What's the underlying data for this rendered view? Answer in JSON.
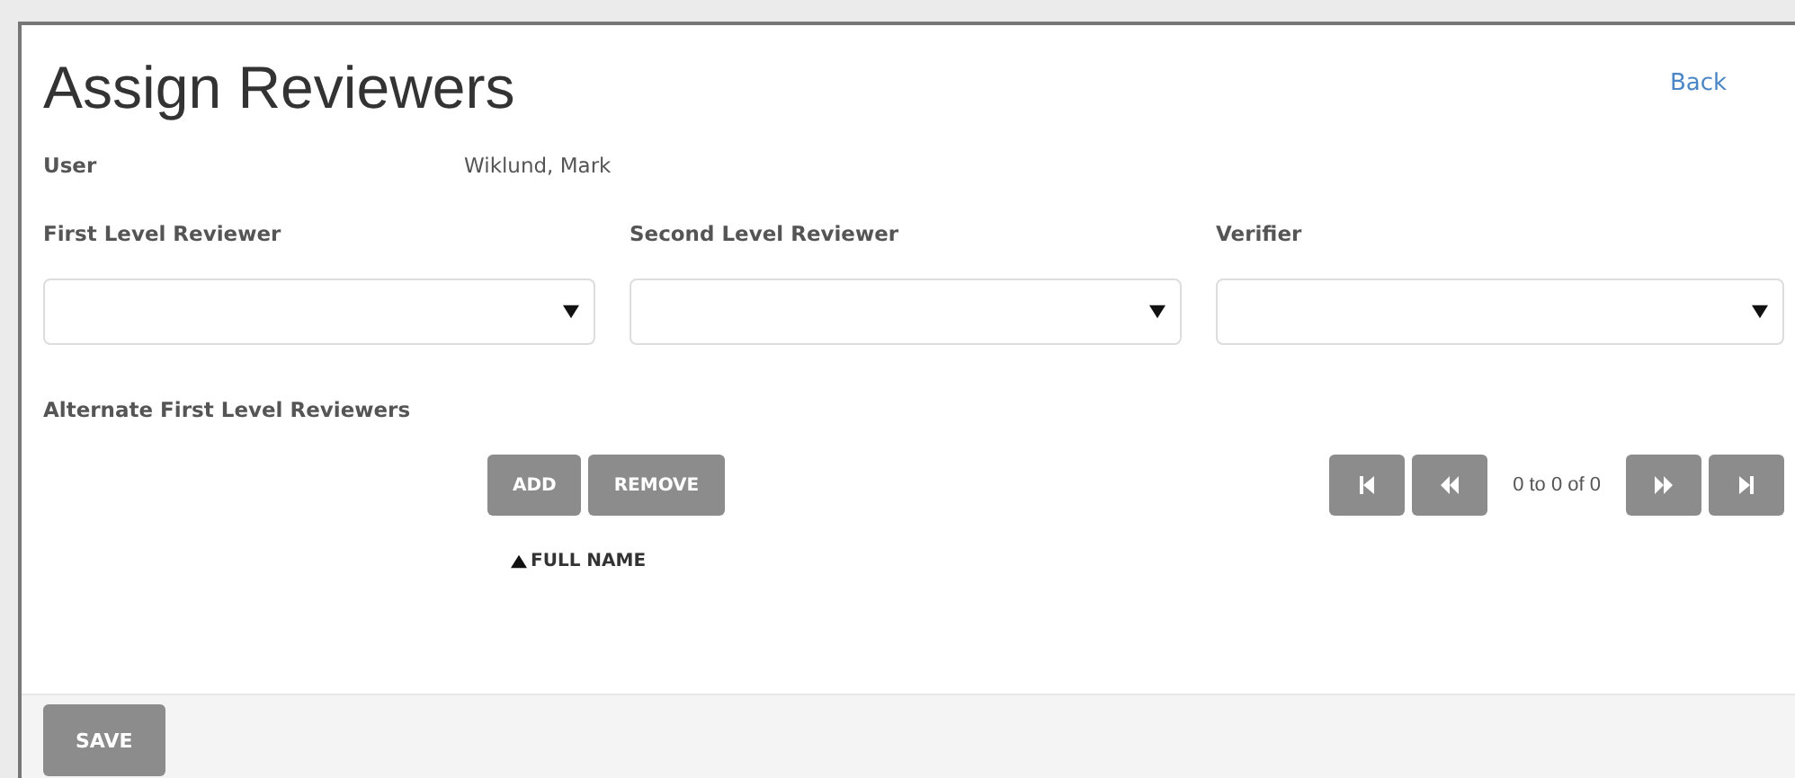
{
  "title": "Assign Reviewers",
  "back_link": "Back",
  "user": {
    "label": "User",
    "value": "Wiklund, Mark"
  },
  "selects": [
    {
      "label": "First Level Reviewer"
    },
    {
      "label": "Second Level Reviewer"
    },
    {
      "label": "Verifier"
    }
  ],
  "alternates": {
    "label": "Alternate First Level Reviewers",
    "buttons": [
      "ADD",
      "REMOVE"
    ],
    "pager_text": "0 to 0 of 0",
    "column": {
      "label": "FULL NAME",
      "sort_ascending": true
    }
  },
  "footer": {
    "save": "SAVE"
  }
}
